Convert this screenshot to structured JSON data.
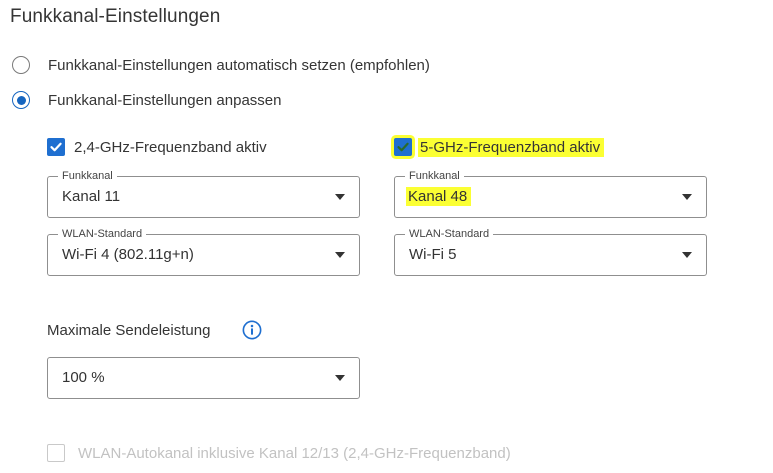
{
  "heading": "Funkkanal-Einstellungen",
  "mode_options": [
    {
      "label": "Funkkanal-Einstellungen automatisch setzen (empfohlen)",
      "selected": false
    },
    {
      "label": "Funkkanal-Einstellungen anpassen",
      "selected": true
    }
  ],
  "band_24": {
    "label": "2,4-GHz-Frequenzband aktiv",
    "checked": true,
    "channel": {
      "legend": "Funkkanal",
      "value": "Kanal 11"
    },
    "standard": {
      "legend": "WLAN-Standard",
      "value": "Wi-Fi 4 (802.11g+n)"
    }
  },
  "band_5": {
    "label": "5-GHz-Frequenzband aktiv",
    "checked": true,
    "channel": {
      "legend": "Funkkanal",
      "value": "Kanal 48"
    },
    "standard": {
      "legend": "WLAN-Standard",
      "value": "Wi-Fi 5"
    }
  },
  "power": {
    "label": "Maximale Sendeleistung",
    "value": "100 %"
  },
  "autochannel": {
    "label": "WLAN-Autokanal inklusive Kanal 12/13 (2,4-GHz-Frequenzband)",
    "checked": false,
    "disabled": true
  },
  "colors": {
    "accent": "#1f6fd0",
    "highlight": "#fbff33",
    "disabled_text": "#c2c2c2"
  },
  "icons": {
    "info": "info-circle-icon",
    "check": "checkmark-icon",
    "caret": "chevron-down-icon"
  }
}
